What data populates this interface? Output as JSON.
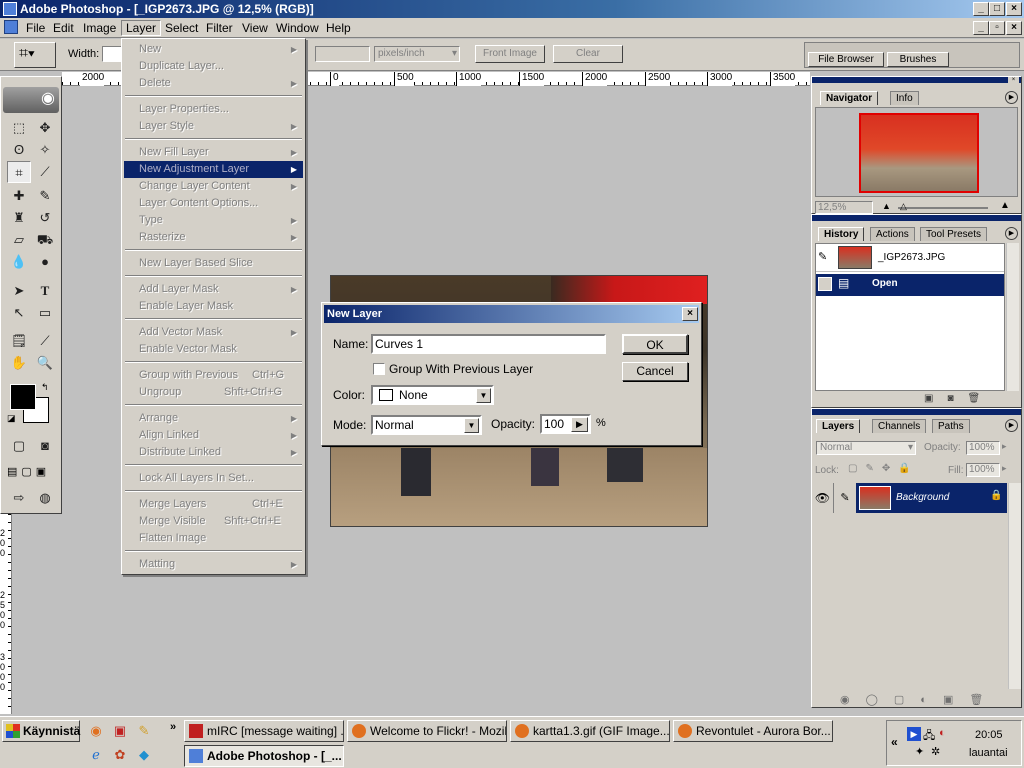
{
  "window": {
    "title": "Adobe Photoshop - [_IGP2673.JPG @ 12,5% (RGB)]"
  },
  "menubar": [
    "File",
    "Edit",
    "Image",
    "Layer",
    "Select",
    "Filter",
    "View",
    "Window",
    "Help"
  ],
  "options": {
    "width_label": "Width:",
    "resolution_unit": "pixels/inch",
    "front_image": "Front Image",
    "clear": "Clear",
    "file_browser": "File Browser",
    "brushes": "Brushes"
  },
  "ruler": {
    "left_value": "2000",
    "ticks": [
      "0",
      "500",
      "1000",
      "1500",
      "2000",
      "2500",
      "3000",
      "3500"
    ],
    "vertical": [
      "2",
      "0",
      "0",
      "2",
      "5",
      "0",
      "0",
      "3",
      "0",
      "0",
      "0"
    ]
  },
  "layer_menu": {
    "items": [
      {
        "label": "New",
        "submenu": true
      },
      {
        "label": "Duplicate Layer..."
      },
      {
        "label": "Delete",
        "submenu": true
      },
      {
        "label": "Layer Properties..."
      },
      {
        "label": "Layer Style",
        "submenu": true
      },
      {
        "label": "New Fill Layer",
        "submenu": true
      },
      {
        "label": "New Adjustment Layer",
        "submenu": true
      },
      {
        "label": "Change Layer Content",
        "submenu": true
      },
      {
        "label": "Layer Content Options..."
      },
      {
        "label": "Type",
        "submenu": true
      },
      {
        "label": "Rasterize",
        "submenu": true
      },
      {
        "label": "New Layer Based Slice"
      },
      {
        "label": "Add Layer Mask",
        "submenu": true
      },
      {
        "label": "Enable Layer Mask"
      },
      {
        "label": "Add Vector Mask",
        "submenu": true
      },
      {
        "label": "Enable Vector Mask"
      },
      {
        "label": "Group with Previous",
        "shortcut": "Ctrl+G"
      },
      {
        "label": "Ungroup",
        "shortcut": "Shft+Ctrl+G"
      },
      {
        "label": "Arrange",
        "submenu": true
      },
      {
        "label": "Align Linked",
        "submenu": true
      },
      {
        "label": "Distribute Linked",
        "submenu": true
      },
      {
        "label": "Lock All Layers In Set..."
      },
      {
        "label": "Merge Layers",
        "shortcut": "Ctrl+E"
      },
      {
        "label": "Merge Visible",
        "shortcut": "Shft+Ctrl+E"
      },
      {
        "label": "Flatten Image"
      },
      {
        "label": "Matting",
        "submenu": true
      }
    ]
  },
  "dialog": {
    "title": "New Layer",
    "name_label": "Name:",
    "name_value": "Curves 1",
    "group_label": "Group With Previous Layer",
    "color_label": "Color:",
    "color_value": "None",
    "mode_label": "Mode:",
    "mode_value": "Normal",
    "opacity_label": "Opacity:",
    "opacity_value": "100",
    "percent": "%",
    "ok": "OK",
    "cancel": "Cancel"
  },
  "navigator": {
    "tabs": [
      "Navigator",
      "Info"
    ],
    "zoom": "12,5%"
  },
  "history": {
    "tabs": [
      "History",
      "Actions",
      "Tool Presets"
    ],
    "snapshot": "_IGP2673.JPG",
    "step": "Open"
  },
  "layers": {
    "tabs": [
      "Layers",
      "Channels",
      "Paths"
    ],
    "blend": "Normal",
    "opacity_label": "Opacity:",
    "opacity": "100%",
    "lock_label": "Lock:",
    "fill_label": "Fill:",
    "fill": "100%",
    "layer_name": "Background"
  },
  "taskbar": {
    "start": "Käynnistä",
    "tasks": [
      "mIRC [message waiting] ...",
      "Welcome to Flickr! - Mozil...",
      "kartta1.3.gif (GIF Image...",
      "Revontulet - Aurora Bor...",
      "Adobe Photoshop - [_..."
    ],
    "time": "20:05",
    "day": "lauantai"
  },
  "colors": {
    "accent": "#0a246a",
    "face": "#d4d0c8"
  }
}
